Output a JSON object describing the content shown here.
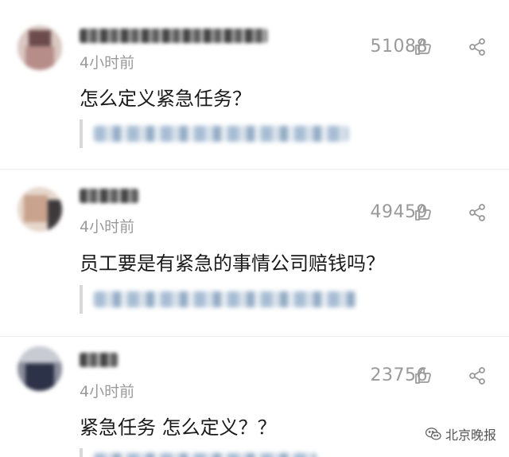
{
  "comments": [
    {
      "time": "4小时前",
      "likes": "51088",
      "text": "怎么定义紧急任务？"
    },
    {
      "time": "4小时前",
      "likes": "49459",
      "text": "员工要是有紧急的事情公司赔钱吗？"
    },
    {
      "time": "4小时前",
      "likes": "23756",
      "text": "紧急任务 怎么定义？？"
    }
  ],
  "icons": {
    "like": "thumbs-up-icon",
    "share": "share-icon",
    "watermark": "wechat-icon"
  },
  "watermark": {
    "text": "北京晚报"
  },
  "colors": {
    "muted": "#9a9a9a",
    "text": "#1a1a1a",
    "background": "#ffffff"
  }
}
